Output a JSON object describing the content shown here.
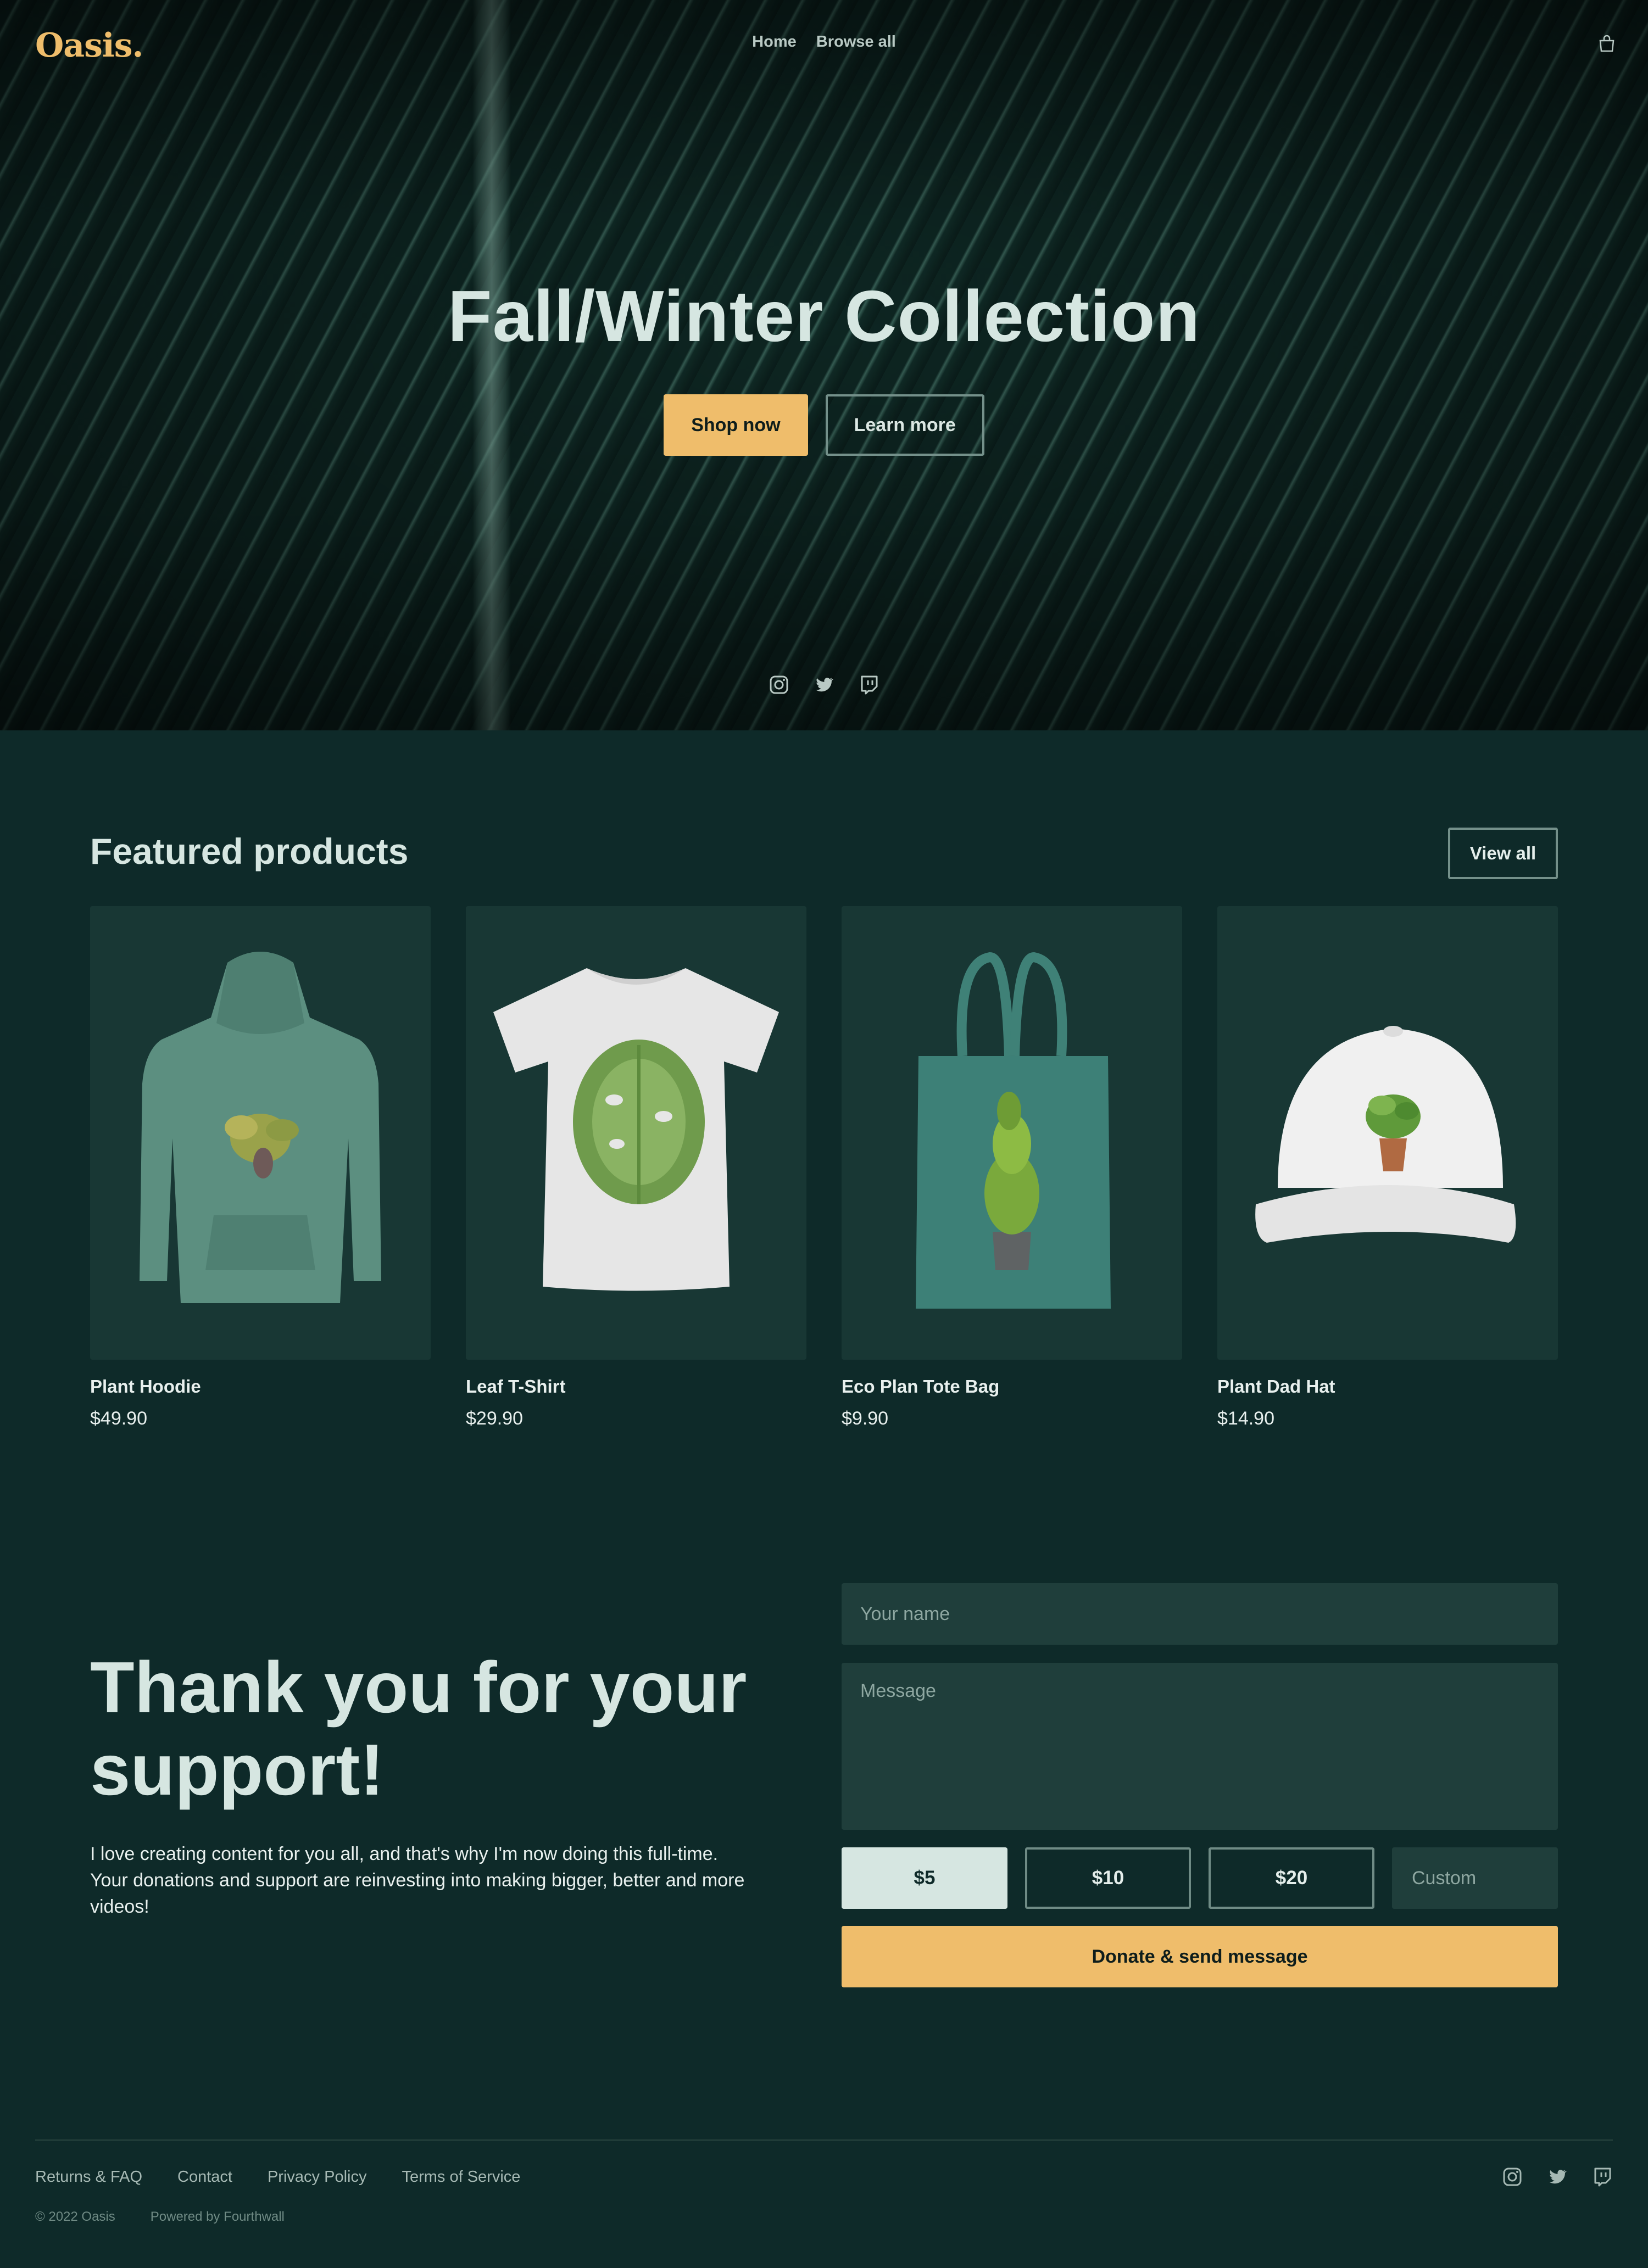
{
  "brand": {
    "logo": "Oasis.",
    "accent": "#efbd6b"
  },
  "nav": {
    "items": [
      "Home",
      "Browse all"
    ]
  },
  "hero": {
    "title": "Fall/Winter Collection",
    "primary_button": "Shop now",
    "secondary_button": "Learn more",
    "social": [
      "instagram-icon",
      "twitter-icon",
      "twitch-icon"
    ]
  },
  "featured": {
    "title": "Featured products",
    "view_all": "View all",
    "products": [
      {
        "name": "Plant Hoodie",
        "price": "$49.90"
      },
      {
        "name": "Leaf T-Shirt",
        "price": "$29.90"
      },
      {
        "name": "Eco Plan Tote Bag",
        "price": "$9.90"
      },
      {
        "name": "Plant Dad Hat",
        "price": "$14.90"
      }
    ]
  },
  "support": {
    "title": "Thank you for your support!",
    "text": "I love creating content for you all, and that's why I'm now doing this full-time. Your donations and support are reinvesting into making bigger, better and more videos!",
    "name_placeholder": "Your name",
    "message_placeholder": "Message",
    "amounts": [
      "$5",
      "$10",
      "$20"
    ],
    "selected_amount": "$5",
    "custom_placeholder": "Custom",
    "donate_button": "Donate & send message"
  },
  "footer": {
    "links": [
      "Returns & FAQ",
      "Contact",
      "Privacy Policy",
      "Terms of Service"
    ],
    "copyright": "© 2022 Oasis",
    "powered": "Powered by Fourthwall",
    "social": [
      "instagram-icon",
      "twitter-icon",
      "twitch-icon"
    ]
  },
  "colors": {
    "background": "#0e2a29",
    "card": "#183734",
    "input": "#1f3e3b",
    "text": "#d6e6e1"
  }
}
